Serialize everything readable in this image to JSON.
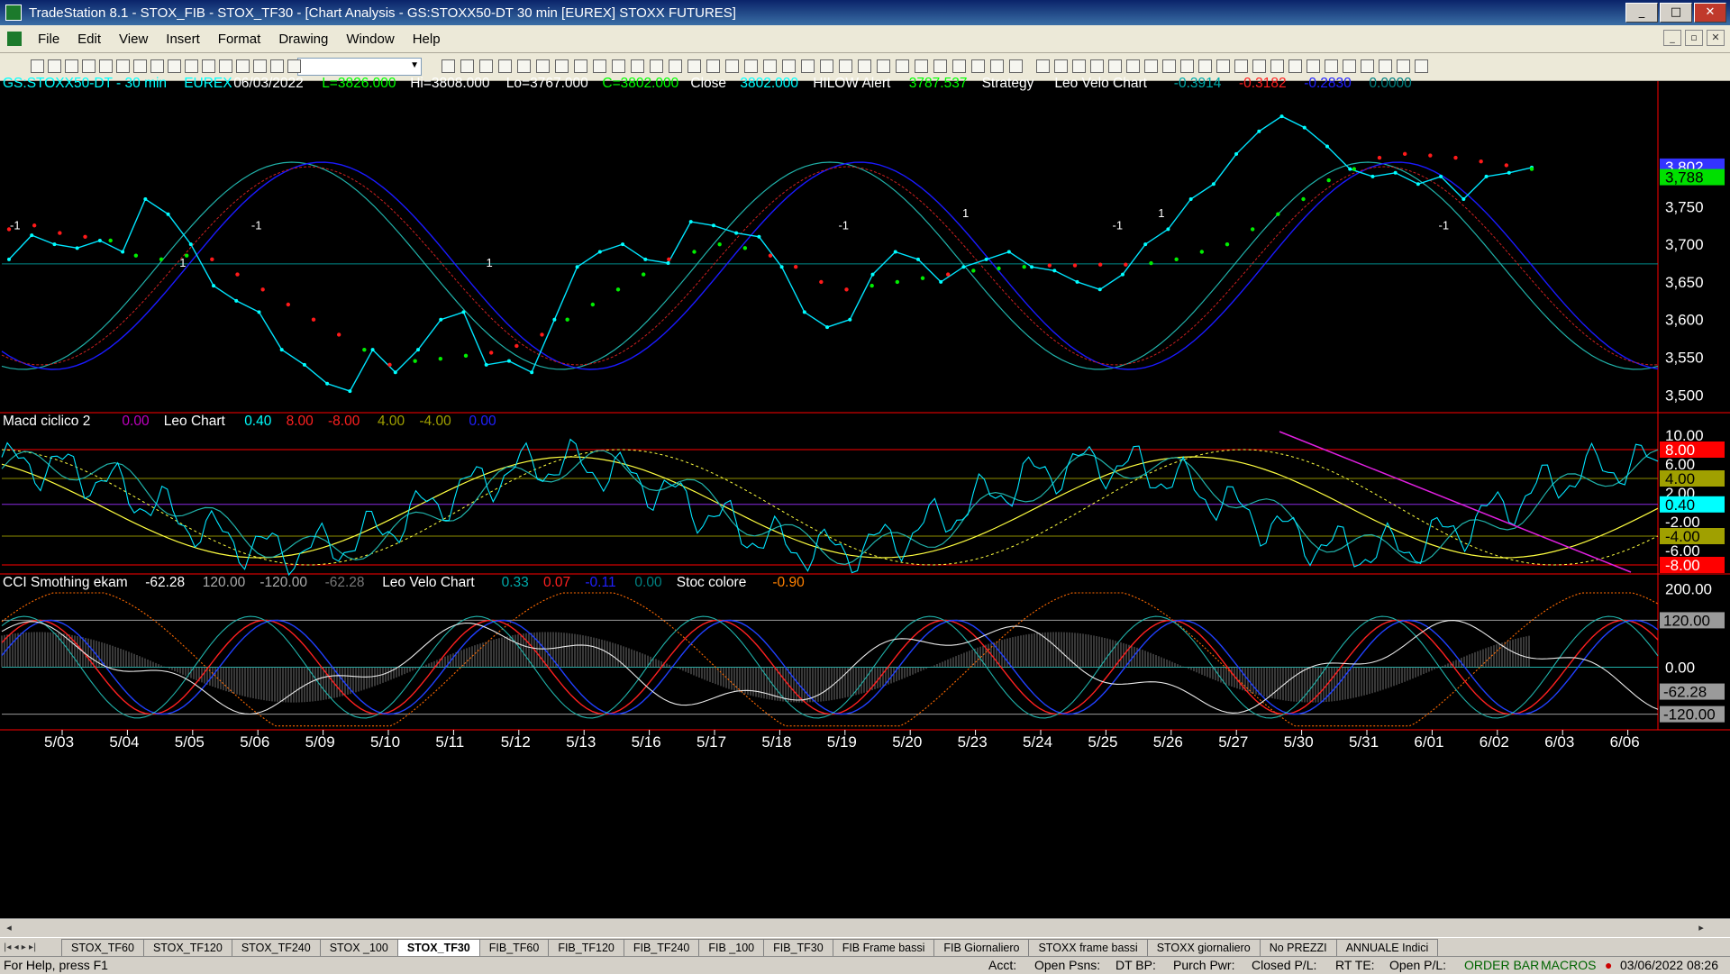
{
  "window": {
    "title": "TradeStation 8.1 - STOX_FIB - STOX_TF30 - [Chart Analysis - GS:STOXX50-DT  30 min  [EUREX] STOXX FUTURES]",
    "min": "_",
    "max": "□",
    "close": "✕"
  },
  "menu": [
    "File",
    "Edit",
    "View",
    "Insert",
    "Format",
    "Drawing",
    "Window",
    "Help"
  ],
  "chart_data": [
    {
      "type": "line",
      "title": "GS:STOXX50-DT - 30 min",
      "header": [
        {
          "t": "GS:STOXX50-DT - 30 min",
          "c": "#00ffff"
        },
        {
          "t": "EUREX",
          "c": "#00ffff"
        },
        {
          "t": "06/03/2022",
          "c": "#ffffff"
        },
        {
          "t": "L=3826.000",
          "c": "#00ff00"
        },
        {
          "t": "Hi=3808.000",
          "c": "#ffffff"
        },
        {
          "t": "Lo=3767.000",
          "c": "#ffffff"
        },
        {
          "t": "C=3802.000",
          "c": "#00ff00"
        },
        {
          "t": "Close",
          "c": "#ffffff"
        },
        {
          "t": "3802.000",
          "c": "#00ffff"
        },
        {
          "t": "HILOW Alert",
          "c": "#ffffff"
        },
        {
          "t": "3787.537",
          "c": "#00ff00"
        },
        {
          "t": "Strategy",
          "c": "#ffffff"
        },
        {
          "t": "Leo Velo Chart",
          "c": "#ffffff"
        },
        {
          "t": "-0.3914",
          "c": "#00aaaa"
        },
        {
          "t": "-0.3182",
          "c": "#ff2020"
        },
        {
          "t": "-0.2830",
          "c": "#2020ff"
        },
        {
          "t": "0.0000",
          "c": "#008080"
        }
      ],
      "ylim": [
        3480,
        3900
      ],
      "yticks": [
        3500,
        3550,
        3600,
        3650,
        3700,
        3750
      ],
      "price_tags": [
        {
          "v": 3802,
          "label": "3,802",
          "bg": "#3333ff",
          "fg": "#ffffff"
        },
        {
          "v": 3788,
          "label": "3,788",
          "bg": "#00e000",
          "fg": "#000000"
        }
      ],
      "hline": 3674,
      "close": [
        3680,
        3712,
        3700,
        3695,
        3705,
        3690,
        3760,
        3740,
        3700,
        3645,
        3625,
        3610,
        3560,
        3540,
        3515,
        3505,
        3560,
        3530,
        3560,
        3600,
        3610,
        3540,
        3545,
        3530,
        3600,
        3670,
        3690,
        3700,
        3680,
        3675,
        3730,
        3725,
        3715,
        3710,
        3670,
        3610,
        3590,
        3600,
        3660,
        3690,
        3680,
        3650,
        3670,
        3680,
        3690,
        3670,
        3665,
        3650,
        3640,
        3660,
        3700,
        3720,
        3760,
        3780,
        3820,
        3850,
        3870,
        3855,
        3830,
        3800,
        3790,
        3795,
        3780,
        3790,
        3760,
        3790,
        3795,
        3802
      ],
      "sar": [
        3720,
        3725,
        3715,
        3710,
        3705,
        3685,
        3680,
        3685,
        3680,
        3660,
        3640,
        3620,
        3600,
        3580,
        3560,
        3540,
        3545,
        3548,
        3552,
        3556,
        3565,
        3580,
        3600,
        3620,
        3640,
        3660,
        3680,
        3690,
        3700,
        3695,
        3685,
        3670,
        3650,
        3640,
        3645,
        3650,
        3655,
        3660,
        3665,
        3668,
        3670,
        3672,
        3672,
        3673,
        3673,
        3675,
        3680,
        3690,
        3700,
        3720,
        3740,
        3760,
        3785,
        3800,
        3815,
        3820,
        3818,
        3815,
        3810,
        3805,
        3800
      ]
    },
    {
      "type": "line",
      "title": "Macd ciclico 2",
      "header": [
        {
          "t": "Macd ciclico 2",
          "c": "#ffffff"
        },
        {
          "t": "0.00",
          "c": "#c000c0"
        },
        {
          "t": "Leo Chart",
          "c": "#ffffff"
        },
        {
          "t": "0.40",
          "c": "#00ffff"
        },
        {
          "t": "8.00",
          "c": "#ff2020"
        },
        {
          "t": "-8.00",
          "c": "#ff2020"
        },
        {
          "t": "4.00",
          "c": "#a0a000"
        },
        {
          "t": "-4.00",
          "c": "#a0a000"
        },
        {
          "t": "0.00",
          "c": "#2020ff"
        }
      ],
      "ylim": [
        -9,
        11
      ],
      "yticks": [
        10,
        6,
        2,
        -2,
        -6
      ],
      "tags": [
        {
          "v": 8,
          "label": "8.00",
          "bg": "#ff0000",
          "fg": "#ffffff"
        },
        {
          "v": 4,
          "label": "4.00",
          "bg": "#a0a000",
          "fg": "#000000"
        },
        {
          "v": 0.4,
          "label": "0.40",
          "bg": "#00ffff",
          "fg": "#000000"
        },
        {
          "v": -4,
          "label": "-4.00",
          "bg": "#a0a000",
          "fg": "#000000"
        },
        {
          "v": -8,
          "label": "-8.00",
          "bg": "#ff0000",
          "fg": "#ffffff"
        }
      ],
      "lines": [
        8,
        4,
        0.4,
        -4,
        -8
      ]
    },
    {
      "type": "line",
      "title": "CCI Smothing ekam",
      "header": [
        {
          "t": "CCI Smothing ekam",
          "c": "#ffffff"
        },
        {
          "t": "-62.28",
          "c": "#ffffff"
        },
        {
          "t": "120.00",
          "c": "#aaaaaa"
        },
        {
          "t": "-120.00",
          "c": "#aaaaaa"
        },
        {
          "t": "-62.28",
          "c": "#777777"
        },
        {
          "t": "Leo Velo Chart",
          "c": "#ffffff"
        },
        {
          "t": "0.33",
          "c": "#00aaaa"
        },
        {
          "t": "0.07",
          "c": "#ff2020"
        },
        {
          "t": "-0.11",
          "c": "#2020ff"
        },
        {
          "t": "0.00",
          "c": "#008080"
        },
        {
          "t": "Stoc colore",
          "c": "#ffffff"
        },
        {
          "t": "-0.90",
          "c": "#ff8000"
        }
      ],
      "ylim": [
        -160,
        220
      ],
      "yticks": [
        200,
        0
      ],
      "tags": [
        {
          "v": 120,
          "label": "120.00",
          "bg": "#9a9a9a",
          "fg": "#000000"
        },
        {
          "v": -62.28,
          "label": "-62.28",
          "bg": "#9a9a9a",
          "fg": "#000000"
        },
        {
          "v": -120,
          "label": "-120.00",
          "bg": "#9a9a9a",
          "fg": "#000000"
        }
      ],
      "lines": [
        120,
        0,
        -120
      ]
    }
  ],
  "xlabels": [
    "5/03",
    "5/04",
    "5/05",
    "5/06",
    "5/09",
    "5/10",
    "5/11",
    "5/12",
    "5/13",
    "5/16",
    "5/17",
    "5/18",
    "5/19",
    "5/20",
    "5/23",
    "5/24",
    "5/25",
    "5/26",
    "5/27",
    "5/30",
    "5/31",
    "6/01",
    "6/02",
    "6/03",
    "6/06"
  ],
  "signals": [
    {
      "text": "-1",
      "day": 0
    },
    {
      "text": "1",
      "day": 2.6
    },
    {
      "text": "-1",
      "day": 3.7
    },
    {
      "text": "1",
      "day": 7.3
    },
    {
      "text": "-1",
      "day": 12.7
    },
    {
      "text": "1",
      "day": 14.6
    },
    {
      "text": "-1",
      "day": 16.9
    },
    {
      "text": "1",
      "day": 17.6
    },
    {
      "text": "-1",
      "day": 21.9
    }
  ],
  "tabs": [
    "STOX_TF60",
    "STOX_TF120",
    "STOX_TF240",
    "STOX _100",
    "STOX_TF30",
    "FIB_TF60",
    "FIB_TF120",
    "FIB_TF240",
    "FIB _100",
    "FIB_TF30",
    "FIB Frame bassi",
    "FIB Giornaliero",
    "STOXX frame bassi",
    "STOXX giornaliero",
    "No PREZZI",
    "ANNUALE Indici"
  ],
  "active_tab": "STOX_TF30",
  "status": {
    "help": "For Help, press F1",
    "acct": "Acct:",
    "open_psns": "Open Psns:",
    "dt_bp": "DT BP:",
    "purch_pwr": "Purch Pwr:",
    "closed_pl": "Closed P/L:",
    "rt_te": "RT TE:",
    "open_pl": "Open P/L:",
    "order_bar": "ORDER BAR",
    "macros": "MACROS",
    "datetime": "03/06/2022 08:26"
  }
}
